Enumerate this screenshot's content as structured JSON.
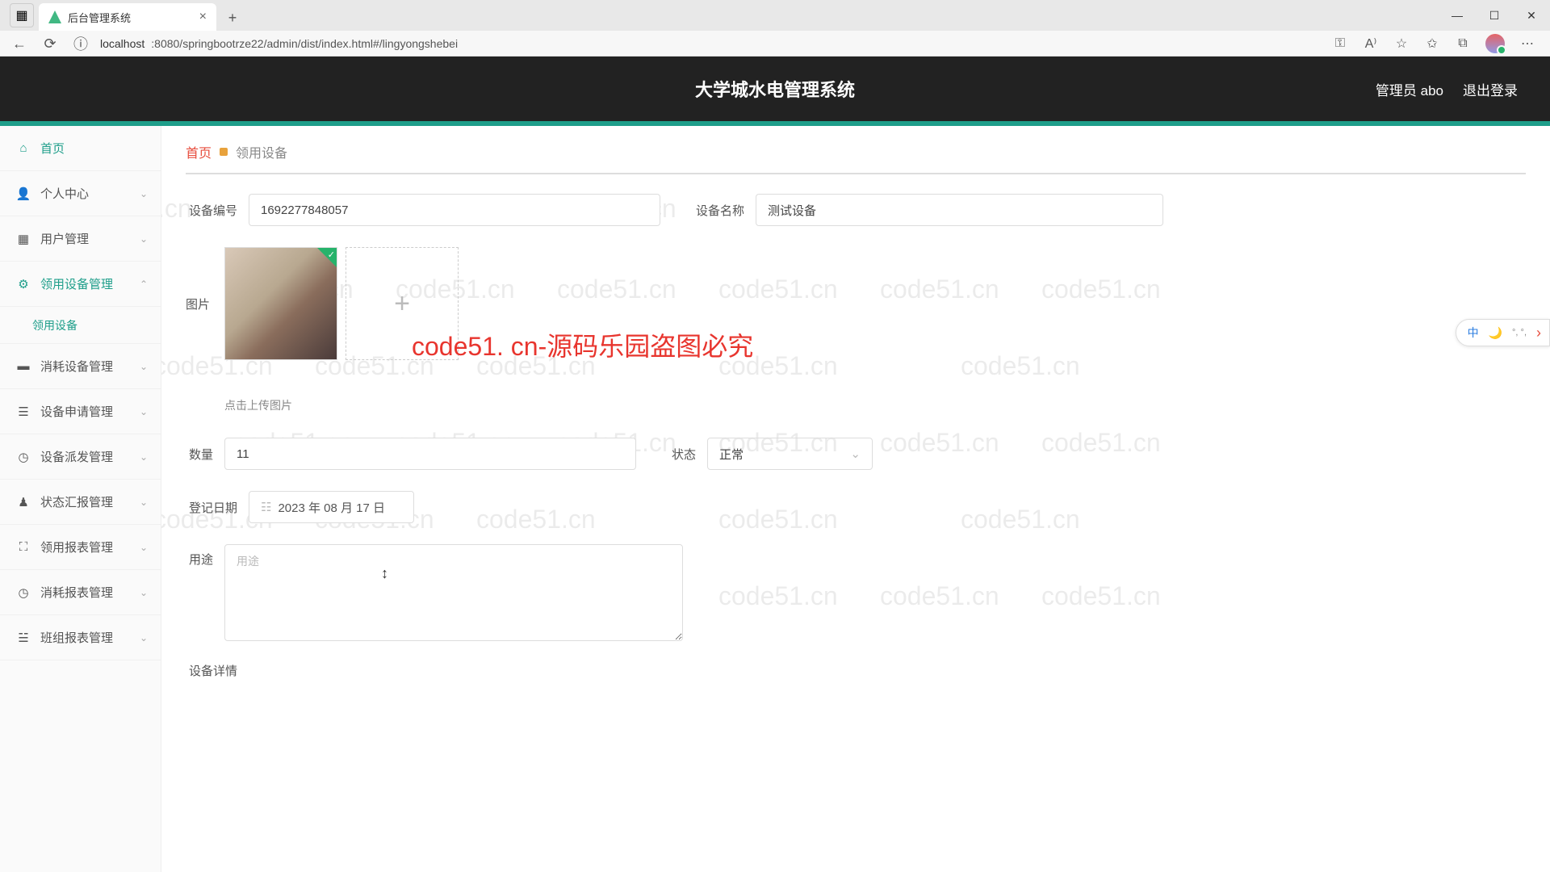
{
  "browser": {
    "tab_title": "后台管理系统",
    "url_prefix": "localhost",
    "url_rest": ":8080/springbootrze22/admin/dist/index.html#/lingyongshebei"
  },
  "header": {
    "app_title": "大学城水电管理系统",
    "user_label": "管理员 abo",
    "logout": "退出登录"
  },
  "sidebar": {
    "items": [
      {
        "label": "首页",
        "icon": "home"
      },
      {
        "label": "个人中心",
        "icon": "user"
      },
      {
        "label": "用户管理",
        "icon": "grid"
      },
      {
        "label": "领用设备管理",
        "icon": "gear"
      },
      {
        "label": "消耗设备管理",
        "icon": "battery"
      },
      {
        "label": "设备申请管理",
        "icon": "clipboard"
      },
      {
        "label": "设备派发管理",
        "icon": "clock"
      },
      {
        "label": "状态汇报管理",
        "icon": "user2"
      },
      {
        "label": "领用报表管理",
        "icon": "scan"
      },
      {
        "label": "消耗报表管理",
        "icon": "clock2"
      },
      {
        "label": "班组报表管理",
        "icon": "doc"
      }
    ],
    "sub_item": "领用设备"
  },
  "breadcrumb": {
    "home": "首页",
    "current": "领用设备"
  },
  "form": {
    "device_id_label": "设备编号",
    "device_id_value": "1692277848057",
    "device_name_label": "设备名称",
    "device_name_value": "测试设备",
    "image_label": "图片",
    "upload_hint": "点击上传图片",
    "qty_label": "数量",
    "qty_value": "11",
    "status_label": "状态",
    "status_value": "正常",
    "date_label": "登记日期",
    "date_value": "2023 年 08 月 17 日",
    "purpose_label": "用途",
    "purpose_placeholder": "用途",
    "detail_label": "设备详情"
  },
  "overlay": {
    "watermark_text": "code51.cn",
    "big_red": "code51. cn-源码乐园盗图必究",
    "ime": "中"
  }
}
